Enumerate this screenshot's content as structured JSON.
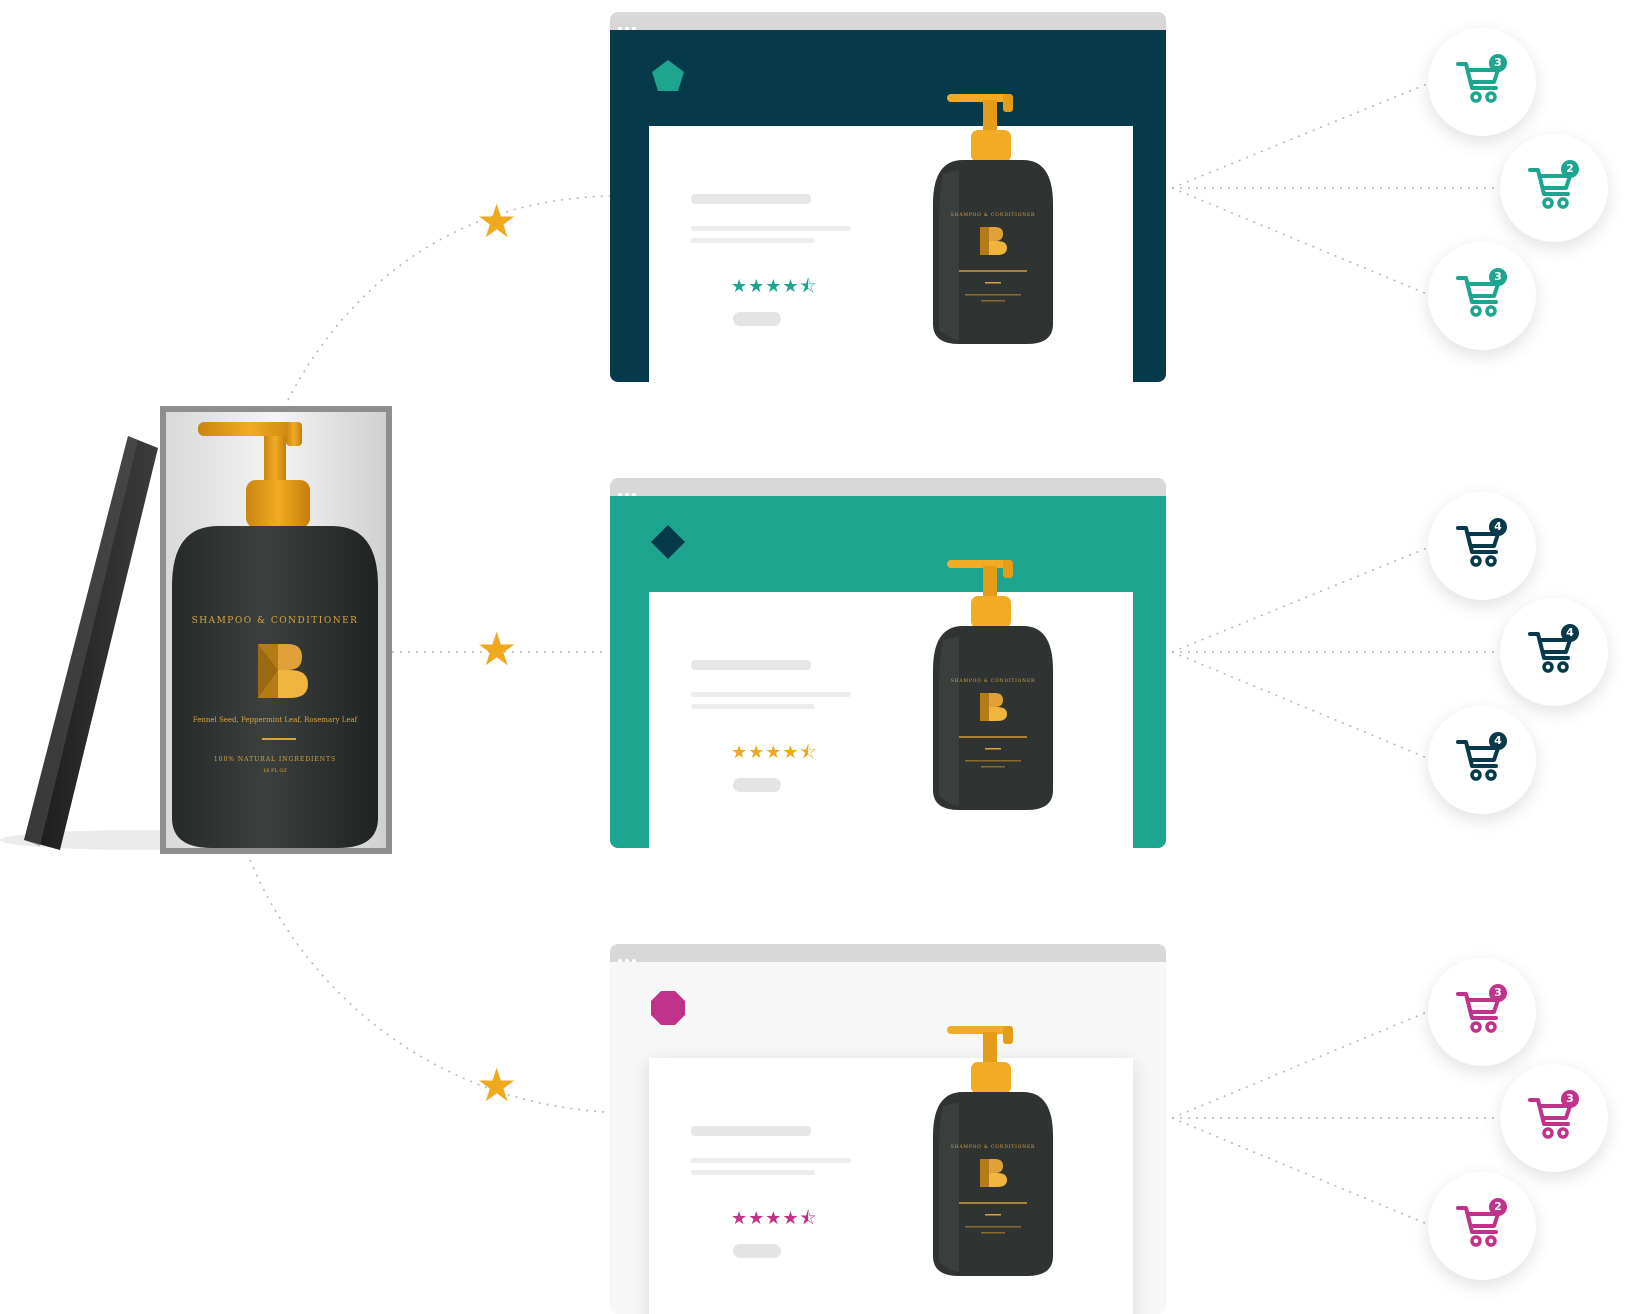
{
  "colors": {
    "navy": "#063a4a",
    "teal": "#1ea58f",
    "magenta": "#c0338a",
    "gold": "#f0a81c",
    "bottle": "#2e3231",
    "label_gold": "#d7a441"
  },
  "product": {
    "name": "SHAMPOO & CONDITIONER",
    "ingredients": "Fennel Seed, Peppermint Leaf, Rosemary Leaf",
    "claim": "100% NATURAL INGREDIENTS",
    "size": "16 FL OZ",
    "logo_icon": "brand-b-icon"
  },
  "connector_icon": "star-icon",
  "variants": [
    {
      "header_color": "#063a4a",
      "sheet_color": "#ffffff",
      "logo_shape": "pentagon-icon",
      "logo_color": "#1ea58f",
      "rating_stars": "★★★★⯪",
      "rating_color": "#1ea58f",
      "carts": [
        {
          "count": "3"
        },
        {
          "count": "2"
        },
        {
          "count": "3"
        }
      ],
      "cart_color": "#1ea58f"
    },
    {
      "header_color": "#1ea58f",
      "sheet_color": "#ffffff",
      "logo_shape": "diamond-icon",
      "logo_color": "#063a4a",
      "rating_stars": "★★★★⯪",
      "rating_color": "#f0a81c",
      "carts": [
        {
          "count": "4"
        },
        {
          "count": "4"
        },
        {
          "count": "4"
        }
      ],
      "cart_color": "#063a4a"
    },
    {
      "header_color": "#f7f7f7",
      "sheet_color": "#ffffff",
      "logo_shape": "octagon-icon",
      "logo_color": "#c0338a",
      "rating_stars": "★★★★⯪",
      "rating_color": "#c0338a",
      "carts": [
        {
          "count": "3"
        },
        {
          "count": "3"
        },
        {
          "count": "2"
        }
      ],
      "cart_color": "#c0338a"
    }
  ]
}
